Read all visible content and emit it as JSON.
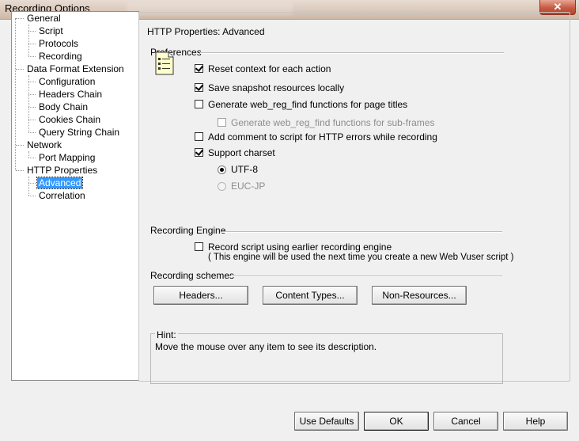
{
  "window": {
    "title": "Recording Options",
    "close_glyph": "✕"
  },
  "tree": [
    {
      "label": "General",
      "level": 0
    },
    {
      "label": "Script",
      "level": 1
    },
    {
      "label": "Protocols",
      "level": 1
    },
    {
      "label": "Recording",
      "level": 1
    },
    {
      "label": "Data Format Extension",
      "level": 0
    },
    {
      "label": "Configuration",
      "level": 1
    },
    {
      "label": "Headers Chain",
      "level": 1
    },
    {
      "label": "Body Chain",
      "level": 1
    },
    {
      "label": "Cookies Chain",
      "level": 1
    },
    {
      "label": "Query String Chain",
      "level": 1
    },
    {
      "label": "Network",
      "level": 0
    },
    {
      "label": "Port Mapping",
      "level": 1
    },
    {
      "label": "HTTP Properties",
      "level": 0
    },
    {
      "label": "Advanced",
      "level": 1,
      "selected": true
    },
    {
      "label": "Correlation",
      "level": 1
    }
  ],
  "panel": {
    "title": "HTTP Properties: Advanced",
    "preferences": {
      "heading": "Preferences",
      "options": [
        {
          "label": "Reset context for each action",
          "checked": true,
          "disabled": false
        },
        {
          "label": "Save snapshot resources locally",
          "checked": true,
          "disabled": false
        },
        {
          "label": "Generate web_reg_find functions for page titles",
          "checked": false,
          "disabled": false
        },
        {
          "label": "Generate web_reg_find functions for sub-frames",
          "checked": false,
          "disabled": true
        },
        {
          "label": "Add comment to script for HTTP errors while recording",
          "checked": false,
          "disabled": false
        },
        {
          "label": "Support charset",
          "checked": true,
          "disabled": false
        }
      ],
      "charsets": [
        {
          "label": "UTF-8",
          "selected": true,
          "disabled": false
        },
        {
          "label": "EUC-JP",
          "selected": false,
          "disabled": true
        }
      ]
    },
    "engine": {
      "heading": "Recording Engine",
      "option": {
        "label": "Record script using earlier recording engine",
        "checked": false
      },
      "note": "( This engine will be used the next time you create a new Web Vuser script )"
    },
    "schemes": {
      "heading": "Recording schemes",
      "buttons": [
        "Headers...",
        "Content Types...",
        "Non-Resources..."
      ]
    },
    "hint": {
      "label": "Hint:",
      "text": "Move the mouse over any item to see its description."
    }
  },
  "footer": {
    "use_defaults": "Use Defaults",
    "ok": "OK",
    "cancel": "Cancel",
    "help": "Help"
  },
  "colors": {
    "selection": "#3399ff",
    "titlebar": "#d9c7b8",
    "close": "#c75b43"
  }
}
